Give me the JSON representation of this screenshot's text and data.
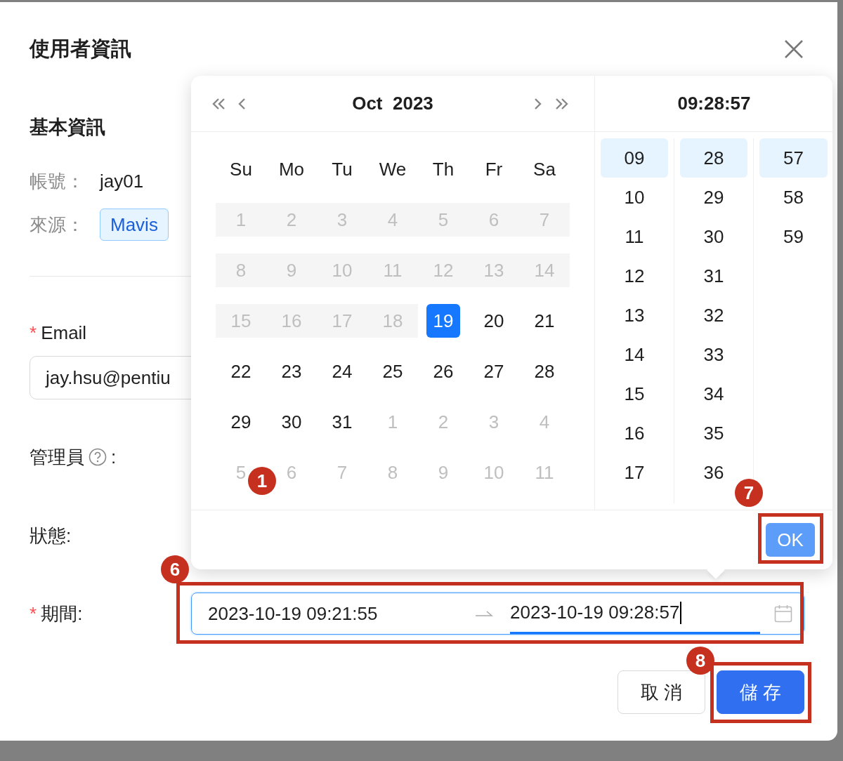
{
  "dialog": {
    "title": "使用者資訊",
    "section_title": "基本資訊",
    "info": [
      {
        "label": "帳號：",
        "value": "jay01",
        "kind": "text"
      },
      {
        "label": "來源：",
        "value": "Mavis",
        "kind": "tag"
      }
    ],
    "fields": [
      {
        "marker": "*",
        "label": "Email",
        "kind": "input",
        "value": "jay.hsu@pentiu"
      },
      {
        "label": "管理員",
        "help": true,
        "suffix": ":",
        "kind": "blank"
      },
      {
        "label": "狀態:",
        "kind": "blank"
      },
      {
        "marker": "*",
        "label": "期間:",
        "kind": "range"
      }
    ],
    "range": {
      "start": "2023-10-19 09:21:55",
      "end": "2023-10-19 09:28:57",
      "end_active": true,
      "highlighted": true,
      "callout": "6"
    },
    "buttons": [
      {
        "label": "取 消",
        "kind": "default"
      },
      {
        "label": "儲 存",
        "kind": "primary",
        "highlighted": true,
        "callout": "8"
      }
    ],
    "picker": {
      "month_label": "Oct  2023",
      "weekdays": [
        "Su",
        "Mo",
        "Tu",
        "We",
        "Th",
        "Fr",
        "Sa"
      ],
      "weeks": [
        [
          {
            "text": "1",
            "kind": "past",
            "selected": false
          },
          {
            "text": "2",
            "kind": "past",
            "selected": false
          },
          {
            "text": "3",
            "kind": "past",
            "selected": false
          },
          {
            "text": "4",
            "kind": "past",
            "selected": false
          },
          {
            "text": "5",
            "kind": "past",
            "selected": false
          },
          {
            "text": "6",
            "kind": "past",
            "selected": false
          },
          {
            "text": "7",
            "kind": "past",
            "selected": false
          }
        ],
        [
          {
            "text": "8",
            "kind": "past",
            "selected": false
          },
          {
            "text": "9",
            "kind": "past",
            "selected": false
          },
          {
            "text": "10",
            "kind": "past",
            "selected": false
          },
          {
            "text": "11",
            "kind": "past",
            "selected": false
          },
          {
            "text": "12",
            "kind": "past",
            "selected": false
          },
          {
            "text": "13",
            "kind": "past",
            "selected": false
          },
          {
            "text": "14",
            "kind": "past",
            "selected": false
          }
        ],
        [
          {
            "text": "15",
            "kind": "past",
            "selected": false
          },
          {
            "text": "16",
            "kind": "past",
            "selected": false
          },
          {
            "text": "17",
            "kind": "past",
            "selected": false
          },
          {
            "text": "18",
            "kind": "past",
            "selected": false
          },
          {
            "text": "19",
            "kind": "current",
            "selected": true
          },
          {
            "text": "20",
            "kind": "current",
            "selected": false
          },
          {
            "text": "21",
            "kind": "current",
            "selected": false
          }
        ],
        [
          {
            "text": "22",
            "kind": "current",
            "selected": false
          },
          {
            "text": "23",
            "kind": "current",
            "selected": false
          },
          {
            "text": "24",
            "kind": "current",
            "selected": false
          },
          {
            "text": "25",
            "kind": "current",
            "selected": false
          },
          {
            "text": "26",
            "kind": "current",
            "selected": false
          },
          {
            "text": "27",
            "kind": "current",
            "selected": false
          },
          {
            "text": "28",
            "kind": "current",
            "selected": false
          }
        ],
        [
          {
            "text": "29",
            "kind": "current",
            "selected": false
          },
          {
            "text": "30",
            "kind": "current",
            "selected": false
          },
          {
            "text": "31",
            "kind": "current",
            "selected": false
          },
          {
            "text": "1",
            "kind": "other",
            "selected": false
          },
          {
            "text": "2",
            "kind": "other",
            "selected": false
          },
          {
            "text": "3",
            "kind": "other",
            "selected": false
          },
          {
            "text": "4",
            "kind": "other",
            "selected": false
          }
        ],
        [
          {
            "text": "5",
            "kind": "other",
            "selected": false,
            "callout": "1"
          },
          {
            "text": "6",
            "kind": "other",
            "selected": false
          },
          {
            "text": "7",
            "kind": "other",
            "selected": false
          },
          {
            "text": "8",
            "kind": "other",
            "selected": false
          },
          {
            "text": "9",
            "kind": "other",
            "selected": false
          },
          {
            "text": "10",
            "kind": "other",
            "selected": false
          },
          {
            "text": "11",
            "kind": "other",
            "selected": false
          }
        ]
      ],
      "time_label": "09:28:57",
      "time_columns": [
        [
          {
            "text": "09",
            "selected": true
          },
          {
            "text": "10",
            "selected": false
          },
          {
            "text": "11",
            "selected": false
          },
          {
            "text": "12",
            "selected": false
          },
          {
            "text": "13",
            "selected": false
          },
          {
            "text": "14",
            "selected": false
          },
          {
            "text": "15",
            "selected": false
          },
          {
            "text": "16",
            "selected": false
          },
          {
            "text": "17",
            "selected": false
          }
        ],
        [
          {
            "text": "28",
            "selected": true
          },
          {
            "text": "29",
            "selected": false
          },
          {
            "text": "30",
            "selected": false
          },
          {
            "text": "31",
            "selected": false
          },
          {
            "text": "32",
            "selected": false
          },
          {
            "text": "33",
            "selected": false
          },
          {
            "text": "34",
            "selected": false
          },
          {
            "text": "35",
            "selected": false
          },
          {
            "text": "36",
            "selected": false
          }
        ],
        [
          {
            "text": "57",
            "selected": true
          },
          {
            "text": "58",
            "selected": false
          },
          {
            "text": "59",
            "selected": false
          }
        ]
      ],
      "ok_button": {
        "label": "OK",
        "highlighted": true,
        "callout": "7"
      }
    }
  }
}
